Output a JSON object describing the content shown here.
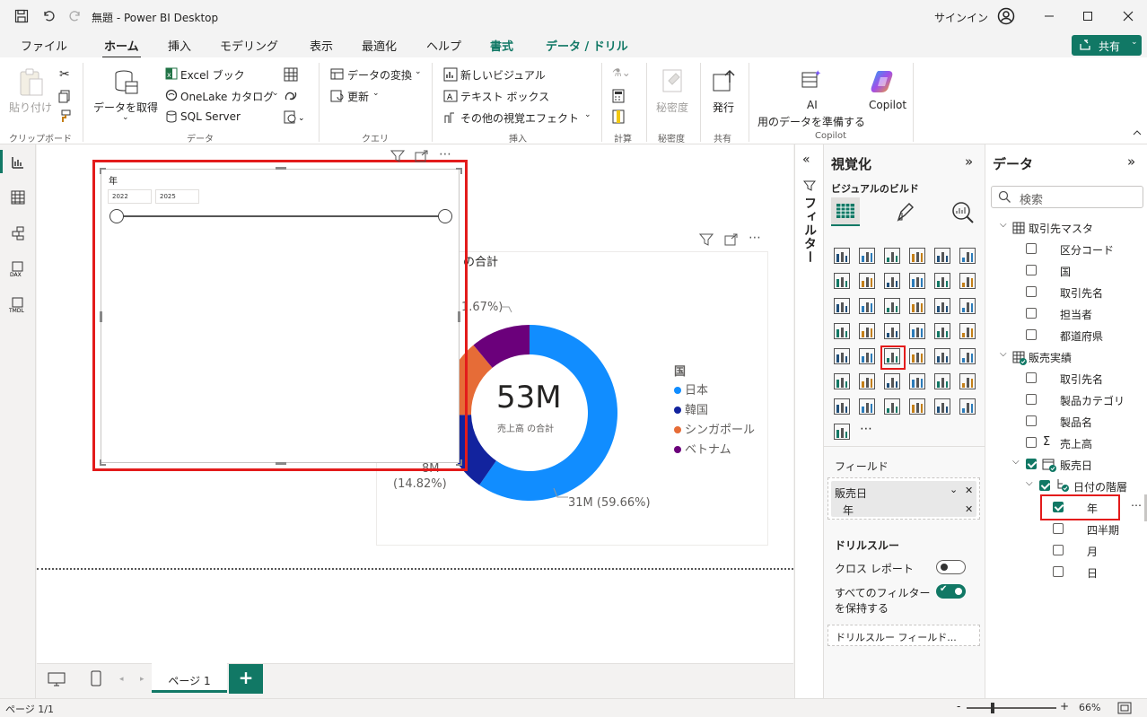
{
  "app": {
    "title": "無題 - Power BI Desktop",
    "signin": "サインイン"
  },
  "tabs": [
    {
      "label": "ファイル"
    },
    {
      "label": "ホーム"
    },
    {
      "label": "挿入"
    },
    {
      "label": "モデリング"
    },
    {
      "label": "表示"
    },
    {
      "label": "最適化"
    },
    {
      "label": "ヘルプ"
    },
    {
      "label": "書式"
    },
    {
      "label": "データ / ドリル"
    }
  ],
  "share_label": "共有",
  "ribbon": {
    "paste": "貼り付け",
    "clipboard": "クリップボード",
    "get_data": "データを取得",
    "excel": "Excel ブック",
    "onelake": "OneLake カタログ",
    "sql": "SQL Server",
    "data_group": "データ",
    "transform": "データの変換",
    "refresh": "更新",
    "query_group": "クエリ",
    "new_visual": "新しいビジュアル",
    "text_box": "テキスト ボックス",
    "more_visuals": "その他の視覚エフェクト",
    "insert_group": "挿入",
    "calc_group": "計算",
    "sensitivity": "秘密度",
    "sensitivity_group": "秘密度",
    "publish": "発行",
    "share_group": "共有",
    "ai_prep_1": "AI",
    "ai_prep_2": "用のデータを準備する",
    "copilot": "Copilot",
    "copilot_group": "Copilot"
  },
  "slicer": {
    "title": "年",
    "from": "2022",
    "to": "2025"
  },
  "donut": {
    "title_partial": "の合計",
    "center_value": "53M",
    "center_label": "売上高 の合計",
    "label_top": "1.67%)",
    "label_left_1": "8M",
    "label_left_2": "(14.82%)",
    "label_bottom": "31M (59.66%)",
    "legend_title": "国",
    "legend": [
      {
        "name": "日本",
        "color": "#118DFF"
      },
      {
        "name": "韓国",
        "color": "#12239E"
      },
      {
        "name": "シンガポール",
        "color": "#E66C37"
      },
      {
        "name": "ベトナム",
        "color": "#6B007B"
      }
    ]
  },
  "filters_label": "フィルター",
  "viz": {
    "title": "視覚化",
    "build": "ビジュアルのビルド",
    "fields_label": "フィールド",
    "well_field": "販売日",
    "well_sub": "年",
    "drillthrough": "ドリルスルー",
    "cross_report": "クロス レポート",
    "keep_filters": "すべてのフィルターを保持する",
    "keep_filters_1": "すべてのフィルター",
    "keep_filters_2": "を保持する",
    "drill_fields": "ドリルスルー フィールド..."
  },
  "data_pane": {
    "title": "データ",
    "search_placeholder": "検索",
    "tables": [
      {
        "name": "取引先マスタ",
        "fields": [
          "区分コード",
          "国",
          "取引先名",
          "担当者",
          "都道府県"
        ]
      },
      {
        "name": "販売実績",
        "fields": [
          "取引先名",
          "製品カテゴリ",
          "製品名",
          "売上高",
          "販売日"
        ]
      }
    ],
    "hierarchy": "日付の階層",
    "hier_items": [
      "年",
      "四半期",
      "月",
      "日"
    ]
  },
  "page_tab": "ページ 1",
  "status": {
    "page": "ページ 1/1",
    "zoom": "66%"
  }
}
